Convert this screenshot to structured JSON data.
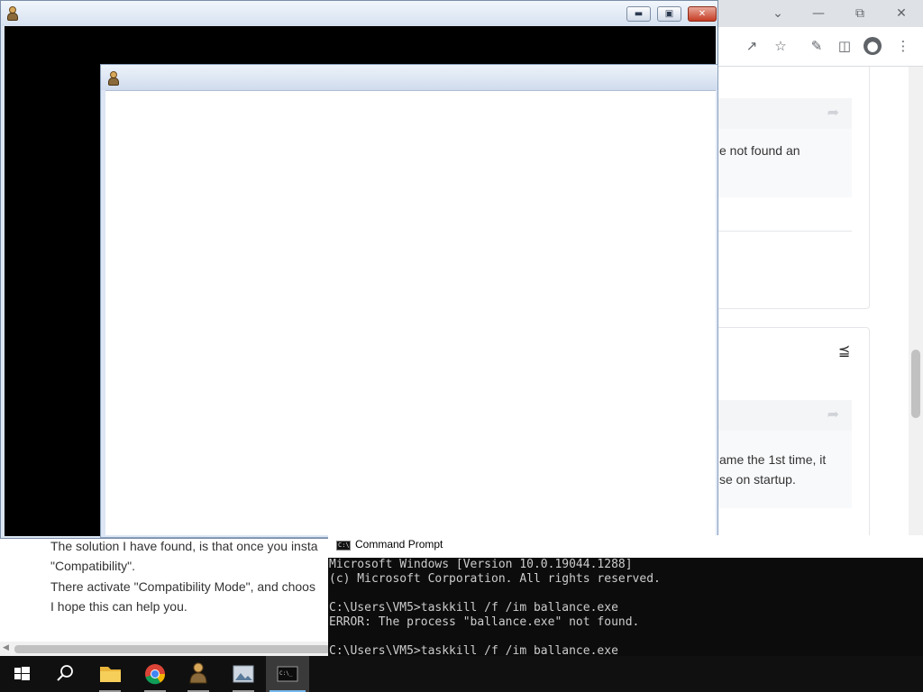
{
  "browser": {
    "content": {
      "card1_text": "e not found an",
      "card2_text_line1": "ame the 1st time, it",
      "card2_text_line2": "se on startup.",
      "bottom_lines": [
        "The solution I have found, is that once you insta",
        "\"Compatibility\".",
        "There activate \"Compatibility Mode\", and choos",
        "I hope this can help you."
      ]
    },
    "icons": [
      "chevron-down-icon",
      "minimize-icon",
      "restore-icon",
      "close-icon",
      "share-page-icon",
      "bookmark-star-icon",
      "extensions-icon",
      "side-panel-icon",
      "profile-icon",
      "more-menu-icon",
      "share-icon"
    ]
  },
  "ballance_window": {
    "title": "",
    "buttons": [
      "minimize",
      "maximize",
      "close"
    ]
  },
  "ballance_child_window": {
    "title": ""
  },
  "cmd": {
    "title": "Command Prompt",
    "lines": [
      "Microsoft Windows [Version 10.0.19044.1288]",
      "(c) Microsoft Corporation. All rights reserved.",
      "",
      "C:\\Users\\VM5>taskkill /f /im ballance.exe",
      "ERROR: The process \"ballance.exe\" not found.",
      "",
      "C:\\Users\\VM5>taskkill /f /im ballance.exe"
    ]
  },
  "taskbar": {
    "items": [
      {
        "name": "start-button",
        "icon": "windows-logo-icon"
      },
      {
        "name": "search-button",
        "icon": "search-icon"
      },
      {
        "name": "file-explorer",
        "icon": "folder-icon"
      },
      {
        "name": "chrome",
        "icon": "chrome-icon"
      },
      {
        "name": "ballance",
        "icon": "ballance-icon"
      },
      {
        "name": "image-app",
        "icon": "image-app-icon"
      },
      {
        "name": "command-prompt",
        "icon": "cmd-icon"
      }
    ]
  },
  "colors": {
    "taskbar": "#101010",
    "taskbar_accent": "#76b9ed",
    "cmd_bg": "#0c0c0c",
    "cmd_text": "#cccccc",
    "window_close": "#c63c24"
  }
}
